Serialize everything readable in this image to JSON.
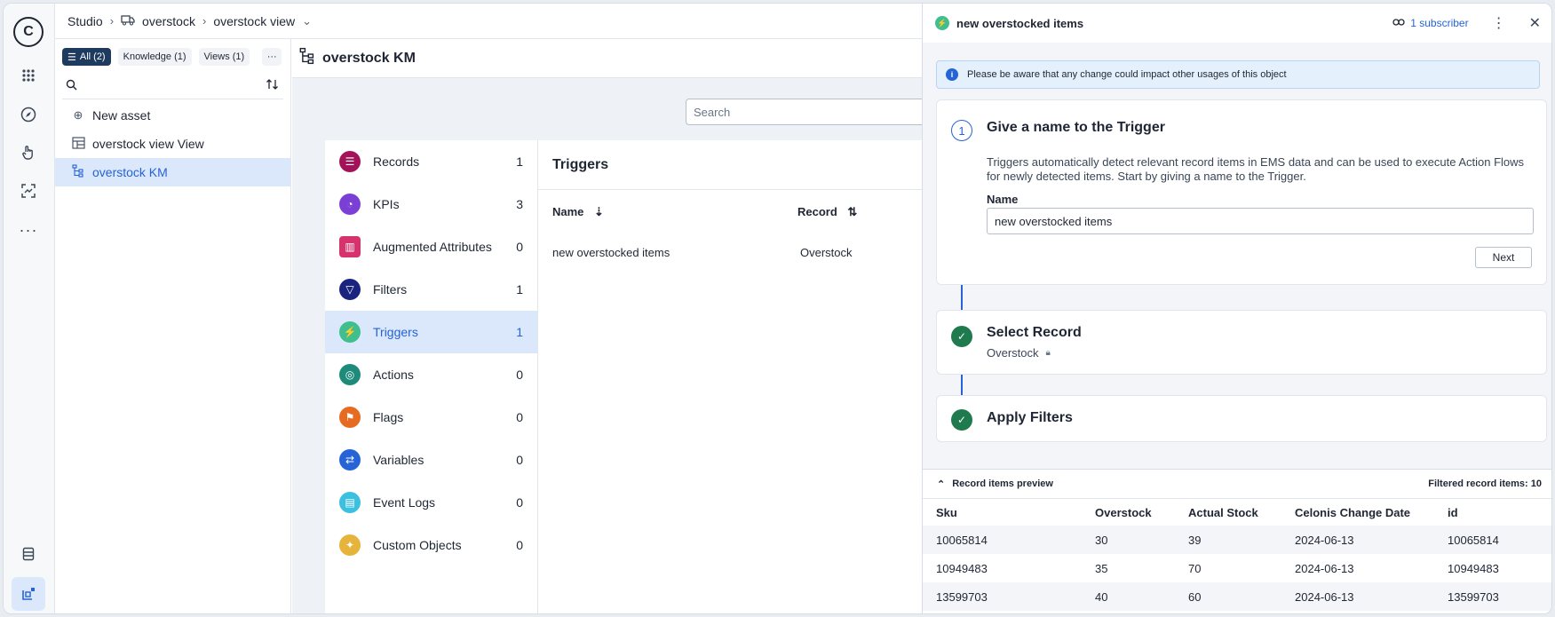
{
  "breadcrumb": {
    "studio": "Studio",
    "package": "overstock",
    "view": "overstock view"
  },
  "rail": {
    "logo": "C"
  },
  "assets": {
    "chips": [
      "All (2)",
      "Knowledge (1)",
      "Views (1)"
    ],
    "more": "···",
    "items": [
      {
        "label": "New asset"
      },
      {
        "label": "overstock view View"
      },
      {
        "label": "overstock KM"
      }
    ]
  },
  "main": {
    "title": "overstock KM",
    "search_placeholder": "Search",
    "categories": [
      {
        "label": "Records",
        "count": "1",
        "color": "#a3135a"
      },
      {
        "label": "KPIs",
        "count": "3",
        "color": "#7b3fd6"
      },
      {
        "label": "Augmented Attributes",
        "count": "0",
        "color": "#d6336c"
      },
      {
        "label": "Filters",
        "count": "1",
        "color": "#1a237e"
      },
      {
        "label": "Triggers",
        "count": "1",
        "color": "#3fbf8f"
      },
      {
        "label": "Actions",
        "count": "0",
        "color": "#1e8a7a"
      },
      {
        "label": "Flags",
        "count": "0",
        "color": "#e66a1f"
      },
      {
        "label": "Variables",
        "count": "0",
        "color": "#2563d6"
      },
      {
        "label": "Event Logs",
        "count": "0",
        "color": "#3cc0e0"
      },
      {
        "label": "Custom Objects",
        "count": "0",
        "color": "#e6b43a"
      }
    ],
    "triggers": {
      "title": "Triggers",
      "col_name": "Name",
      "col_record": "Record",
      "rows": [
        {
          "name": "new overstocked items",
          "record": "Overstock"
        }
      ]
    }
  },
  "drawer": {
    "title": "new overstocked items",
    "subscribers": "1 subscriber",
    "notice": "Please be aware that any change could impact other usages of this object",
    "step1": {
      "number": "1",
      "title": "Give a name to the Trigger",
      "description": "Triggers automatically detect relevant record items in EMS data and can be used to execute Action Flows for newly detected items. Start by giving a name to the Trigger.",
      "name_label": "Name",
      "name_value": "new overstocked items",
      "next": "Next"
    },
    "step2": {
      "title": "Select Record",
      "value": "Overstock"
    },
    "step3": {
      "title": "Apply Filters"
    },
    "preview": {
      "title": "Record items preview",
      "count": "Filtered record items: 10",
      "columns": [
        "Sku",
        "Overstock",
        "Actual Stock",
        "Celonis Change Date",
        "id"
      ],
      "rows": [
        [
          "10065814",
          "30",
          "39",
          "2024-06-13",
          "10065814"
        ],
        [
          "10949483",
          "35",
          "70",
          "2024-06-13",
          "10949483"
        ],
        [
          "13599703",
          "40",
          "60",
          "2024-06-13",
          "13599703"
        ]
      ]
    }
  }
}
